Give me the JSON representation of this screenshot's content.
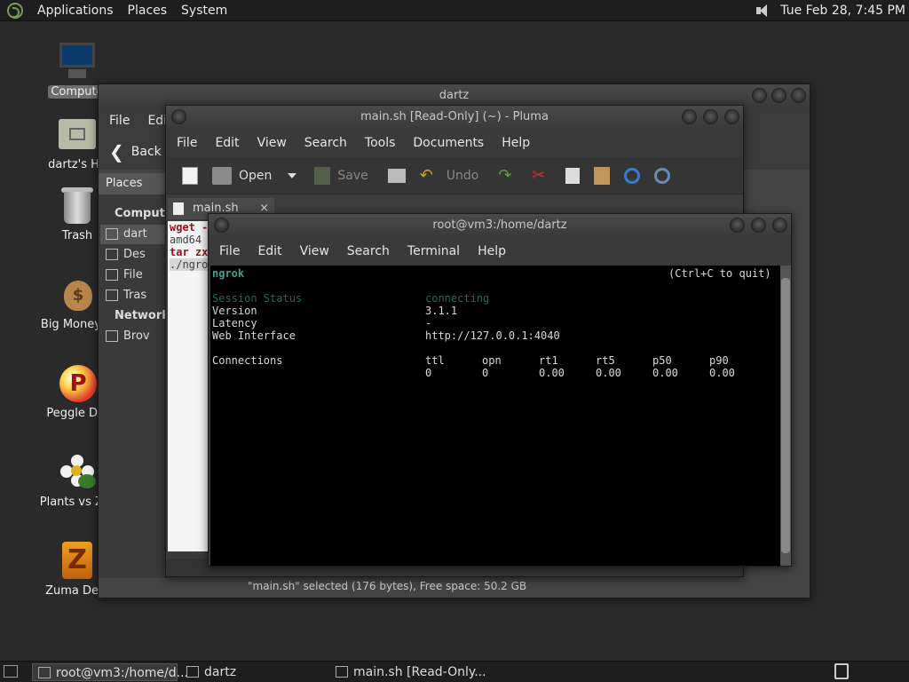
{
  "top_panel": {
    "menus": [
      "Applications",
      "Places",
      "System"
    ],
    "clock": "Tue Feb 28,  7:45 PM"
  },
  "desktop_icons": [
    {
      "label": "Compute",
      "icon": "computer-icon"
    },
    {
      "label": "dartz's Ho",
      "icon": "home-folder-icon"
    },
    {
      "label": "Trash",
      "icon": "trash-icon"
    },
    {
      "label": "Big Money D",
      "icon": "money-bag-icon"
    },
    {
      "label": "Peggle Del",
      "icon": "peggle-icon"
    },
    {
      "label": "Plants vs Zor",
      "icon": "plants-vs-zombies-icon"
    },
    {
      "label": "Zuma Delu",
      "icon": "zuma-icon"
    }
  ],
  "caja": {
    "title": "dartz",
    "menu": [
      "File",
      "Edit"
    ],
    "back_label": "Back",
    "places_header": "Places",
    "section_computer": "Compute",
    "items": [
      "dart",
      "Des",
      "File",
      "Tras"
    ],
    "section_network": "Network",
    "network_item": "Brov",
    "status": "\"main.sh\" selected (176 bytes), Free space: 50.2 GB"
  },
  "pluma": {
    "title": "main.sh [Read-Only] (~) - Pluma",
    "menu": [
      "File",
      "Edit",
      "View",
      "Search",
      "Tools",
      "Documents",
      "Help"
    ],
    "toolbar": {
      "open": "Open",
      "save": "Save",
      "undo": "Undo"
    },
    "tab_label": "main.sh",
    "tab_close": "×",
    "editor_lines": [
      {
        "text": "wget -",
        "keyword": true
      },
      {
        "text": "amd64",
        "keyword": false
      },
      {
        "text": "tar zx",
        "keyword": true
      },
      {
        "text": "./ngro",
        "keyword": false,
        "selected": true
      }
    ]
  },
  "terminal": {
    "title": "root@vm3:/home/dartz",
    "menu": [
      "File",
      "Edit",
      "View",
      "Search",
      "Terminal",
      "Help"
    ],
    "app_name": "ngrok",
    "quit_hint": "(Ctrl+C to quit)",
    "session_status_label": "Session Status",
    "session_status_value": "connecting",
    "version_label": "Version",
    "version_value": "3.1.1",
    "latency_label": "Latency",
    "latency_value": "-",
    "web_label": "Web Interface",
    "web_value": "http://127.0.0.1:4040",
    "connections_label": "Connections",
    "conn_headers": [
      "ttl",
      "opn",
      "rt1",
      "rt5",
      "p50",
      "p90"
    ],
    "conn_values": [
      "0",
      "0",
      "0.00",
      "0.00",
      "0.00",
      "0.00"
    ]
  },
  "taskbar": {
    "tasks": [
      "root@vm3:/home/d...",
      "dartz",
      "main.sh [Read-Only..."
    ]
  }
}
